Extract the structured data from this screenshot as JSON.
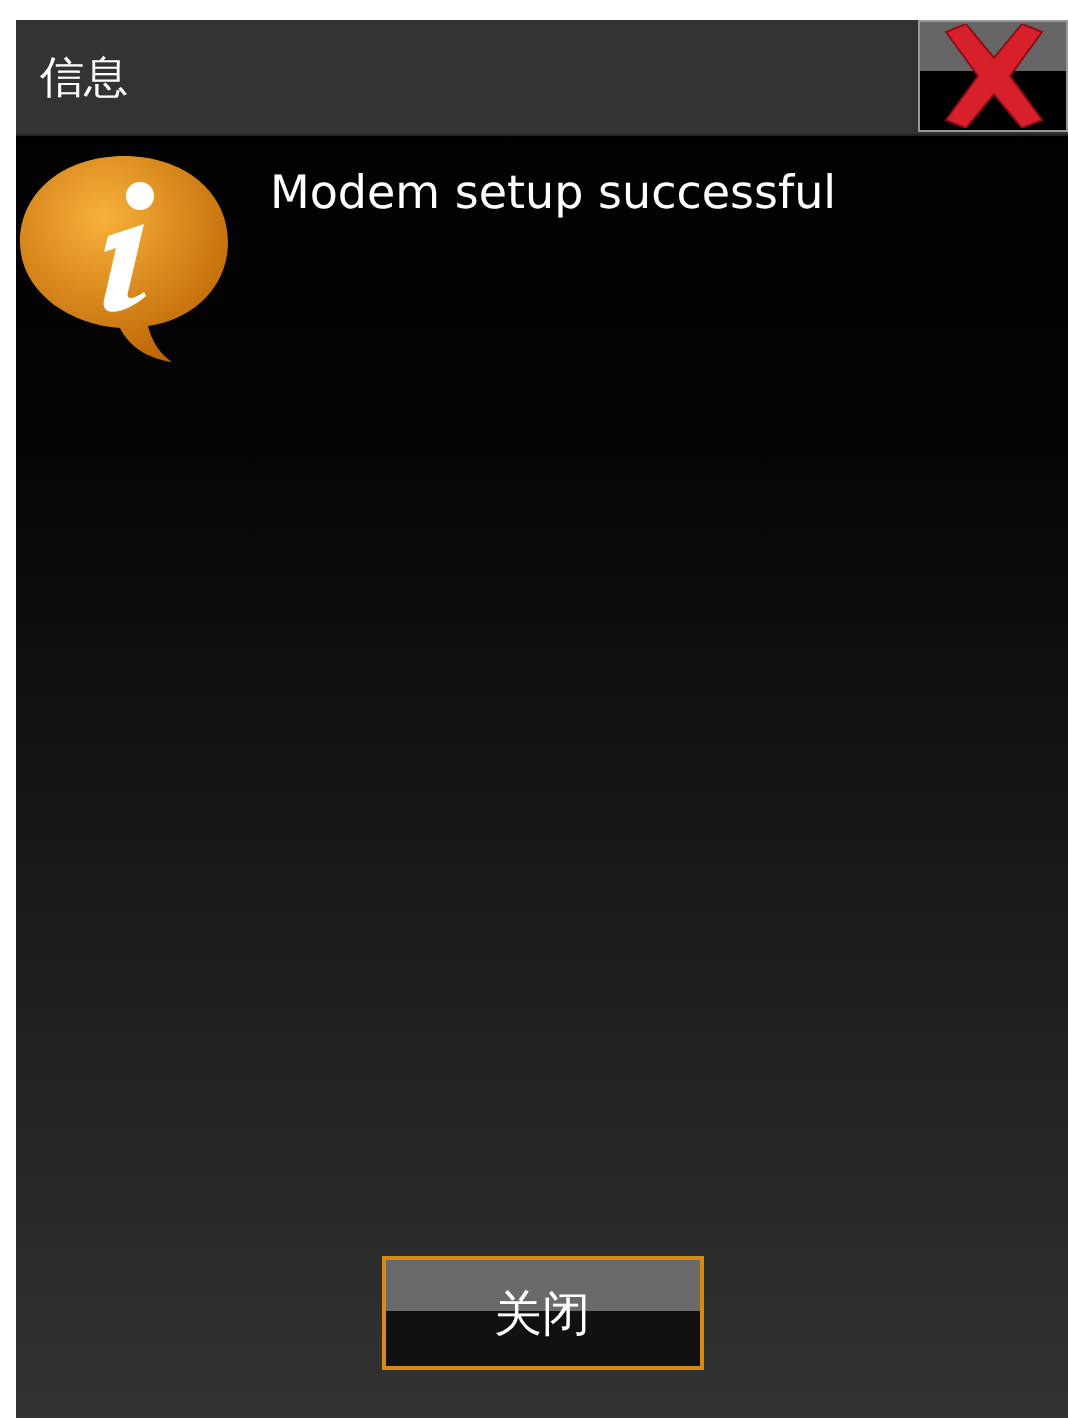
{
  "window": {
    "title": "信息"
  },
  "message": "Modem setup successful",
  "buttons": [
    {
      "label": "关闭",
      "focused": true
    }
  ]
}
